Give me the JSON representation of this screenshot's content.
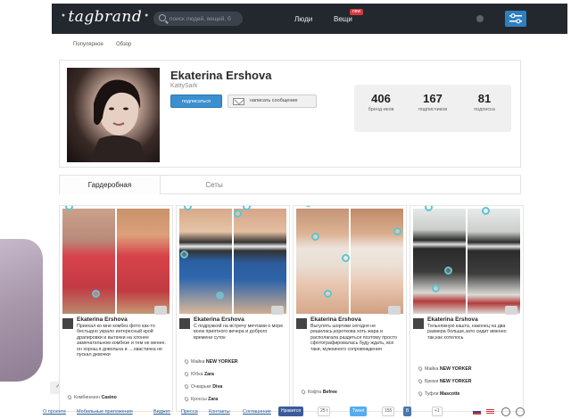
{
  "header": {
    "logo": "tagbrand",
    "search_placeholder": "поиск людей, вещей, б",
    "nav": [
      {
        "label": "Люди"
      },
      {
        "label": "Вещи",
        "badge": "new"
      }
    ],
    "accent": "#2f7fc0"
  },
  "subnav": [
    {
      "label": "Популярное"
    },
    {
      "label": "Обзор"
    }
  ],
  "profile": {
    "name": "Ekaterina Ershova",
    "nickname": "KattySark",
    "subscribe_label": "подписаться",
    "message_label": "написать сообщение",
    "stats": [
      {
        "value": "406",
        "label": "бренд-иков"
      },
      {
        "value": "167",
        "label": "подписчиков"
      },
      {
        "value": "81",
        "label": "подписка"
      }
    ]
  },
  "tabs": [
    {
      "label": "Гардеробная",
      "active": true
    },
    {
      "label": "Сеты",
      "active": false
    }
  ],
  "cards": [
    {
      "author": "Ekaterina Ershova",
      "text": "Приехал ко мне комбез фото как-то бестыдно украло интересный крой драпировки и вытачки на хлонее замечательном комбезе и тем не менее. он хорош,я довольна и ....хвастинка не пускал девочки",
      "items": [
        {
          "label": "Комбинезон",
          "brand": "Casino"
        }
      ]
    },
    {
      "author": "Ekaterina Ershova",
      "text": "С подружкой на встречу мечтами о море всем приятного вечера и доброго времени суток",
      "items": [
        {
          "label": "Майка",
          "brand": "NEW YORKER"
        },
        {
          "label": "Юбка",
          "brand": "Zara"
        },
        {
          "label": "Очкарьке",
          "brand": "Diva"
        },
        {
          "label": "Кроссы",
          "brand": "Zara"
        }
      ]
    },
    {
      "author": "Ekaterina Ershova",
      "text": "Выгулять шортики сегодня не решилась,короткова хоть жара и располагала раздеться поэтому просто сфотографировалась буду ждать, все таки, мужниного сопровождения",
      "items": [
        {
          "label": "Кофта",
          "brand": "Befree"
        }
      ]
    },
    {
      "author": "Ekaterina Ershova",
      "text": "Тельняжную кашта, наконец на два размера больше,зато сидит именно так,как хотелось",
      "items": [
        {
          "label": "Майка",
          "brand": "NEW YORKER"
        },
        {
          "label": "Брюки",
          "brand": "NEW YORKER"
        },
        {
          "label": "Туфли",
          "brand": "Mascotte"
        }
      ]
    }
  ],
  "footer": {
    "links": [
      "О проекте",
      "Мобильные приложения",
      "Виджет",
      "Пресса",
      "Контакты",
      "Соглашение"
    ],
    "share": [
      {
        "label": "Нравится",
        "count": "25 t"
      },
      {
        "label": "Tweet",
        "count": "155"
      },
      {
        "label": "В",
        "count": "+1"
      }
    ],
    "icons": [
      "flag-ru-icon",
      "flag-us-icon",
      "round-icon",
      "round-icon"
    ]
  }
}
